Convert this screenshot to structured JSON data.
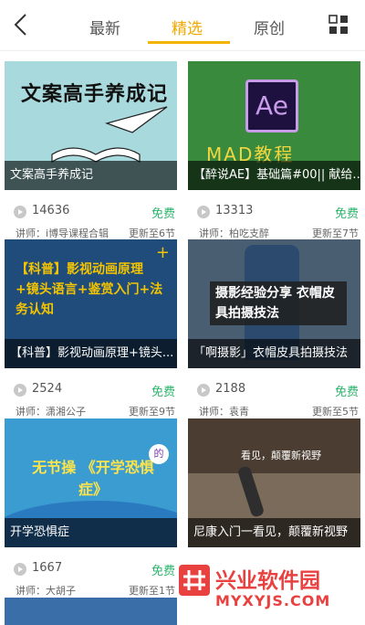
{
  "header": {
    "tabs": [
      {
        "label": "最新",
        "active": false
      },
      {
        "label": "精选",
        "active": true
      },
      {
        "label": "原创",
        "active": false
      }
    ],
    "back_icon": "chevron-left-icon",
    "grid_icon": "grid-view-icon",
    "accent_color": "#f0a800"
  },
  "cards": [
    {
      "thumb_text": "文案高手养成记",
      "caption": "文案高手养成记",
      "views": "14636",
      "price": "免费",
      "teacher": "讲师：i博导课程合辑",
      "progress": "更新至6节"
    },
    {
      "thumb_text": "MAD教程",
      "caption": "【醉说AE】基础篇#00|| 献给...",
      "views": "13313",
      "price": "免费",
      "teacher": "讲师：柏吃支醉",
      "progress": "更新至7节"
    },
    {
      "thumb_text": "【科普】影视动画原理+镜头语言+鉴赏入门+法务认知",
      "caption": "【科普】影视动画原理+镜头...",
      "views": "2524",
      "price": "免费",
      "teacher": "讲师：潇湘公子",
      "progress": "更新至9节"
    },
    {
      "thumb_text": "摄影经验分享 衣帽皮具拍摄技法",
      "caption": "「啊摄影」衣帽皮具拍摄技法",
      "views": "2188",
      "price": "免费",
      "teacher": "讲师：袁青",
      "progress": "更新至5节"
    },
    {
      "thumb_text": "无节操 《开学恐惧症》",
      "caption": "开学恐惧症",
      "views": "",
      "price": "",
      "teacher": "",
      "progress": ""
    },
    {
      "thumb_text": "看见，颠覆新视野",
      "caption": "尼康入门一看见，颠覆新视野",
      "views": "",
      "price": "",
      "teacher": "",
      "progress": ""
    },
    {
      "views": "1667",
      "price": "免费",
      "teacher": "讲师：大胡子",
      "progress": "更新至1节"
    }
  ],
  "watermark": {
    "name": "兴业软件园",
    "url": "MYXYJS.COM"
  },
  "colors": {
    "free": "#2bb46b",
    "watermark": "#e94040"
  }
}
